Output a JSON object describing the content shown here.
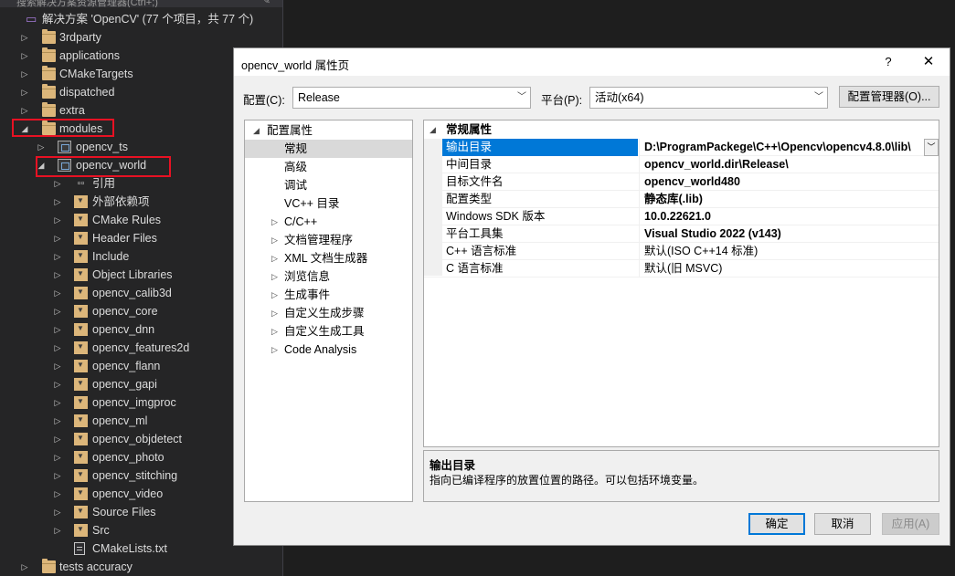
{
  "solution_explorer": {
    "top_hint": "搜索解决方案资源管理器(Ctrl+;)",
    "solution_label": "解决方案 'OpenCV' (77 个项目，共 77 个)",
    "items": [
      {
        "label": "3rdparty",
        "level": 1,
        "expander": "collapsed",
        "icon": "folder-icon"
      },
      {
        "label": "applications",
        "level": 1,
        "expander": "collapsed",
        "icon": "folder-icon"
      },
      {
        "label": "CMakeTargets",
        "level": 1,
        "expander": "collapsed",
        "icon": "folder-icon"
      },
      {
        "label": "dispatched",
        "level": 1,
        "expander": "collapsed",
        "icon": "folder-icon"
      },
      {
        "label": "extra",
        "level": 1,
        "expander": "collapsed",
        "icon": "folder-icon"
      },
      {
        "label": "modules",
        "level": 1,
        "expander": "expanded",
        "icon": "folder-icon"
      },
      {
        "label": "opencv_ts",
        "level": 2,
        "expander": "collapsed",
        "icon": "project-icon"
      },
      {
        "label": "opencv_world",
        "level": 2,
        "expander": "expanded",
        "icon": "project-icon"
      },
      {
        "label": "引用",
        "level": 3,
        "expander": "collapsed",
        "icon": "references-icon"
      },
      {
        "label": "外部依赖项",
        "level": 3,
        "expander": "collapsed",
        "icon": "external-deps-icon"
      },
      {
        "label": "CMake Rules",
        "level": 3,
        "expander": "collapsed",
        "icon": "filter-folder-icon"
      },
      {
        "label": "Header Files",
        "level": 3,
        "expander": "collapsed",
        "icon": "filter-folder-icon"
      },
      {
        "label": "Include",
        "level": 3,
        "expander": "collapsed",
        "icon": "filter-folder-icon"
      },
      {
        "label": "Object Libraries",
        "level": 3,
        "expander": "collapsed",
        "icon": "filter-folder-icon"
      },
      {
        "label": "opencv_calib3d",
        "level": 3,
        "expander": "collapsed",
        "icon": "filter-folder-icon"
      },
      {
        "label": "opencv_core",
        "level": 3,
        "expander": "collapsed",
        "icon": "filter-folder-icon"
      },
      {
        "label": "opencv_dnn",
        "level": 3,
        "expander": "collapsed",
        "icon": "filter-folder-icon"
      },
      {
        "label": "opencv_features2d",
        "level": 3,
        "expander": "collapsed",
        "icon": "filter-folder-icon"
      },
      {
        "label": "opencv_flann",
        "level": 3,
        "expander": "collapsed",
        "icon": "filter-folder-icon"
      },
      {
        "label": "opencv_gapi",
        "level": 3,
        "expander": "collapsed",
        "icon": "filter-folder-icon"
      },
      {
        "label": "opencv_imgproc",
        "level": 3,
        "expander": "collapsed",
        "icon": "filter-folder-icon"
      },
      {
        "label": "opencv_ml",
        "level": 3,
        "expander": "collapsed",
        "icon": "filter-folder-icon"
      },
      {
        "label": "opencv_objdetect",
        "level": 3,
        "expander": "collapsed",
        "icon": "filter-folder-icon"
      },
      {
        "label": "opencv_photo",
        "level": 3,
        "expander": "collapsed",
        "icon": "filter-folder-icon"
      },
      {
        "label": "opencv_stitching",
        "level": 3,
        "expander": "collapsed",
        "icon": "filter-folder-icon"
      },
      {
        "label": "opencv_video",
        "level": 3,
        "expander": "collapsed",
        "icon": "filter-folder-icon"
      },
      {
        "label": "Source Files",
        "level": 3,
        "expander": "collapsed",
        "icon": "filter-folder-icon"
      },
      {
        "label": "Src",
        "level": 3,
        "expander": "collapsed",
        "icon": "filter-folder-icon"
      },
      {
        "label": "CMakeLists.txt",
        "level": 3,
        "expander": "none",
        "icon": "file-icon"
      },
      {
        "label": "tests accuracy",
        "level": 1,
        "expander": "collapsed",
        "icon": "folder-icon"
      }
    ]
  },
  "dialog": {
    "title": "opencv_world 属性页",
    "help": "?",
    "close": "✕",
    "config_label": "配置(C):",
    "config_value": "Release",
    "platform_label": "平台(P):",
    "platform_value": "活动(x64)",
    "config_manager": "配置管理器(O)...",
    "tree": [
      {
        "label": "配置属性",
        "level": 0,
        "expander": "expanded",
        "selected": false
      },
      {
        "label": "常规",
        "level": 1,
        "expander": "none",
        "selected": true
      },
      {
        "label": "高级",
        "level": 1,
        "expander": "none",
        "selected": false
      },
      {
        "label": "调试",
        "level": 1,
        "expander": "none",
        "selected": false
      },
      {
        "label": "VC++ 目录",
        "level": 1,
        "expander": "none",
        "selected": false
      },
      {
        "label": "C/C++",
        "level": 1,
        "expander": "collapsed",
        "selected": false
      },
      {
        "label": "文档管理程序",
        "level": 1,
        "expander": "collapsed",
        "selected": false
      },
      {
        "label": "XML 文档生成器",
        "level": 1,
        "expander": "collapsed",
        "selected": false
      },
      {
        "label": "浏览信息",
        "level": 1,
        "expander": "collapsed",
        "selected": false
      },
      {
        "label": "生成事件",
        "level": 1,
        "expander": "collapsed",
        "selected": false
      },
      {
        "label": "自定义生成步骤",
        "level": 1,
        "expander": "collapsed",
        "selected": false
      },
      {
        "label": "自定义生成工具",
        "level": 1,
        "expander": "collapsed",
        "selected": false
      },
      {
        "label": "Code Analysis",
        "level": 1,
        "expander": "collapsed",
        "selected": false
      }
    ],
    "category": "常规属性",
    "properties": [
      {
        "name": "输出目录",
        "value": "D:\\ProgramPackege\\C++\\Opencv\\opencv4.8.0\\lib\\",
        "bold": true,
        "selected": true,
        "dropdown": true
      },
      {
        "name": "中间目录",
        "value": "opencv_world.dir\\Release\\",
        "bold": true,
        "selected": false,
        "dropdown": false
      },
      {
        "name": "目标文件名",
        "value": "opencv_world480",
        "bold": true,
        "selected": false,
        "dropdown": false
      },
      {
        "name": "配置类型",
        "value": "静态库(.lib)",
        "bold": true,
        "selected": false,
        "dropdown": false
      },
      {
        "name": "Windows SDK 版本",
        "value": "10.0.22621.0",
        "bold": true,
        "selected": false,
        "dropdown": false
      },
      {
        "name": "平台工具集",
        "value": "Visual Studio 2022 (v143)",
        "bold": true,
        "selected": false,
        "dropdown": false
      },
      {
        "name": "C++ 语言标准",
        "value": "默认(ISO C++14 标准)",
        "bold": false,
        "selected": false,
        "dropdown": false
      },
      {
        "name": "C 语言标准",
        "value": "默认(旧 MSVC)",
        "bold": false,
        "selected": false,
        "dropdown": false
      }
    ],
    "description_title": "输出目录",
    "description_text": "指向已编译程序的放置位置的路径。可以包括环境变量。",
    "ok": "确定",
    "cancel": "取消",
    "apply": "应用(A)"
  },
  "colors": {
    "highlight_box": "#e81123",
    "selection_blue": "#0078d7",
    "folder": "#dcb67a",
    "dark_bg": "#252526"
  }
}
